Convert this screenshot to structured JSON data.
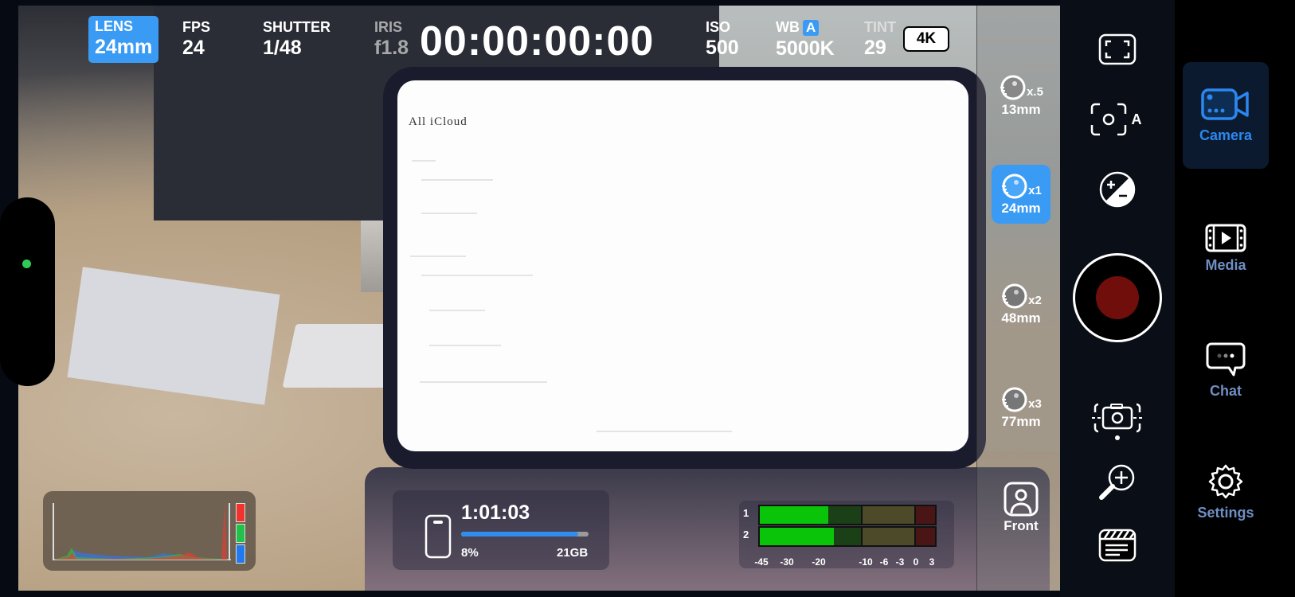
{
  "top_bar": {
    "lens": {
      "label": "LENS",
      "value": "24mm"
    },
    "fps": {
      "label": "FPS",
      "value": "24"
    },
    "shutter": {
      "label": "SHUTTER",
      "value": "1/48"
    },
    "iris": {
      "label": "IRIS",
      "value": "f1.8"
    },
    "timecode": "00:00:00:00",
    "iso": {
      "label": "ISO",
      "value": "500"
    },
    "wb": {
      "label": "WB",
      "badge": "A",
      "value": "5000K"
    },
    "tint": {
      "label": "TINT",
      "value": "29"
    },
    "resolution": "4K"
  },
  "viewfinder": {
    "screen_title": "All iCloud"
  },
  "lens_selector": {
    "lenses": [
      {
        "multiplier": "x.5",
        "focal": "13mm",
        "active": false
      },
      {
        "multiplier": "x1",
        "focal": "24mm",
        "active": true
      },
      {
        "multiplier": "x2",
        "focal": "48mm",
        "active": false
      },
      {
        "multiplier": "x3",
        "focal": "77mm",
        "active": false
      }
    ],
    "front_label": "Front"
  },
  "recording": {
    "remaining_time": "1:01:03",
    "storage_used_percent": 8,
    "storage_used_label": "8%",
    "storage_free": "21GB"
  },
  "audio_meter": {
    "channels": [
      {
        "label": "1",
        "level_db": -14
      },
      {
        "label": "2",
        "level_db": -13
      }
    ],
    "scale": [
      "-45",
      "-30",
      "-20",
      "-10",
      "-6",
      "-3",
      "0",
      "3"
    ]
  },
  "histogram": {
    "channels": [
      "red",
      "green",
      "blue"
    ]
  },
  "controls": {
    "icons": [
      "fullscreen-icon",
      "auto-focus-icon",
      "exposure-compensation-icon",
      "record-icon",
      "stabilization-icon",
      "zoom-in-icon",
      "clapperboard-icon"
    ],
    "autofocus_badge": "A"
  },
  "nav": {
    "items": [
      {
        "label": "Camera",
        "icon": "video-camera-icon",
        "active": true
      },
      {
        "label": "Media",
        "icon": "film-play-icon",
        "active": false
      },
      {
        "label": "Chat",
        "icon": "chat-bubble-icon",
        "active": false
      },
      {
        "label": "Settings",
        "icon": "gear-icon",
        "active": false
      }
    ]
  },
  "colors": {
    "accent": "#3a9bf4",
    "record": "#6f0e0b",
    "meter_green": "#0ac40a",
    "nav_active": "#2c87ef",
    "nav_inactive": "#6e8fc4",
    "status_dot": "#2ecc55"
  }
}
